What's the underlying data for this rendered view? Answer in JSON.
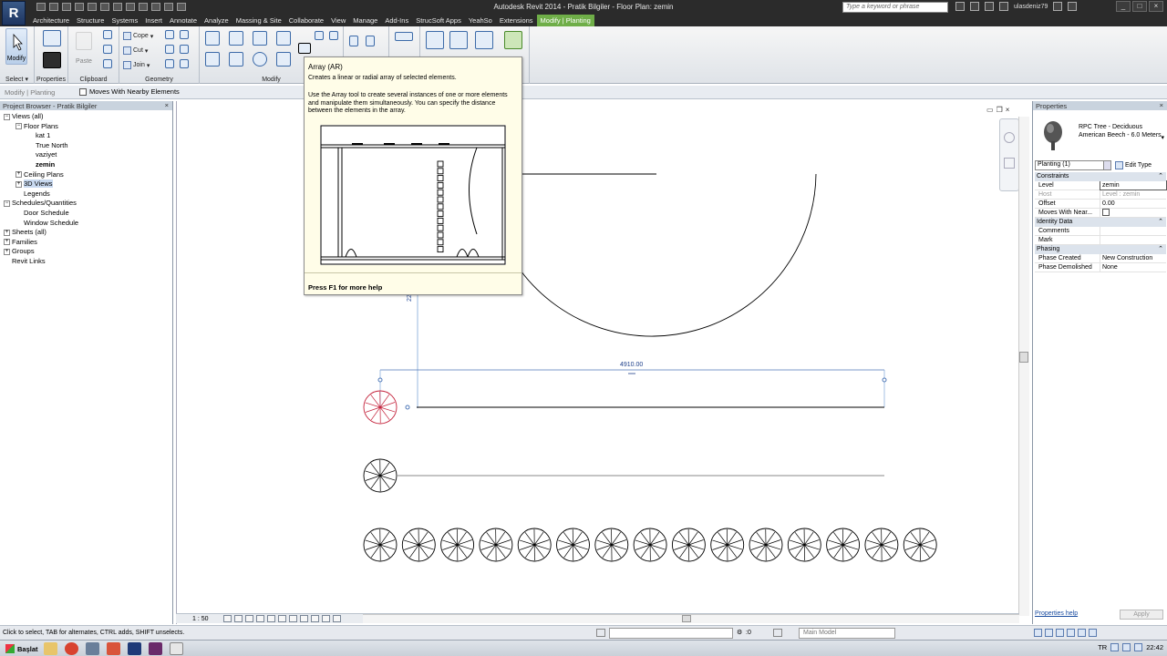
{
  "app": {
    "logo_letter": "R",
    "window_title": "Autodesk Revit 2014 -    Pratik Bilgiler - Floor Plan: zemin",
    "search_placeholder": "Type a keyword or phrase",
    "username": "ulasdeniz79"
  },
  "tabs": [
    {
      "label": "Architecture",
      "active": false
    },
    {
      "label": "Structure",
      "active": false
    },
    {
      "label": "Systems",
      "active": false
    },
    {
      "label": "Insert",
      "active": false
    },
    {
      "label": "Annotate",
      "active": false
    },
    {
      "label": "Analyze",
      "active": false
    },
    {
      "label": "Massing & Site",
      "active": false
    },
    {
      "label": "Collaborate",
      "active": false
    },
    {
      "label": "View",
      "active": false
    },
    {
      "label": "Manage",
      "active": false
    },
    {
      "label": "Add-Ins",
      "active": false
    },
    {
      "label": "StrucSoft Apps",
      "active": false
    },
    {
      "label": "YeahSo",
      "active": false
    },
    {
      "label": "Extensions",
      "active": false
    },
    {
      "label": "Modify | Planting",
      "active": true
    }
  ],
  "ribbon": {
    "modify_label": "Modify",
    "select_label": "Select",
    "properties_panel": "Properties",
    "clipboard_panel": "Clipboard",
    "geometry_panel": "Geometry",
    "modify_panel": "Modify",
    "paste_label": "Paste",
    "cope_label": "Cope",
    "cut_label": "Cut",
    "join_label": "Join"
  },
  "options_bar": {
    "context": "Modify | Planting",
    "moves_label": "Moves With Nearby Elements"
  },
  "project_browser": {
    "title": "Project Browser - Pratik Bilgiler",
    "items": [
      {
        "label": "Views (all)",
        "level": 0,
        "exp": "−"
      },
      {
        "label": "Floor Plans",
        "level": 1,
        "exp": "−"
      },
      {
        "label": "kat 1",
        "level": 2,
        "exp": ""
      },
      {
        "label": "True North",
        "level": 2,
        "exp": ""
      },
      {
        "label": "vaziyet",
        "level": 2,
        "exp": ""
      },
      {
        "label": "zemin",
        "level": 2,
        "exp": "",
        "bold": true
      },
      {
        "label": "Ceiling Plans",
        "level": 1,
        "exp": "+"
      },
      {
        "label": "3D Views",
        "level": 1,
        "exp": "+",
        "highlight": true
      },
      {
        "label": "Legends",
        "level": 1,
        "exp": ""
      },
      {
        "label": "Schedules/Quantities",
        "level": 0,
        "exp": "−"
      },
      {
        "label": "Door Schedule",
        "level": 1,
        "exp": ""
      },
      {
        "label": "Window Schedule",
        "level": 1,
        "exp": ""
      },
      {
        "label": "Sheets (all)",
        "level": 0,
        "exp": "+"
      },
      {
        "label": "Families",
        "level": 0,
        "exp": "+"
      },
      {
        "label": "Groups",
        "level": 0,
        "exp": "+"
      },
      {
        "label": "Revit Links",
        "level": 0,
        "exp": ""
      }
    ]
  },
  "tooltip": {
    "title": "Array (AR)",
    "subtitle": "Creates a linear or radial array of selected elements.",
    "description": "Use the Array tool to create several instances of one or more elements and manipulate them simultaneously. You can specify the distance between the elements in the array.",
    "help": "Press F1 for more help"
  },
  "canvas": {
    "dimension_value": "4910.00",
    "temp_dim": "22",
    "trees_in_array": 15
  },
  "view_control": {
    "scale": "1 : 50"
  },
  "properties": {
    "title": "Properties",
    "type_name": "RPC Tree - Deciduous American Beech - 6.0 Meters",
    "instance_filter": "Planting (1)",
    "edit_type": "Edit Type",
    "groups": [
      {
        "name": "Constraints",
        "rows": [
          {
            "key": "Level",
            "value": "zemin",
            "boxed": true
          },
          {
            "key": "Host",
            "value": "Level : zemin",
            "grey": true
          },
          {
            "key": "Offset",
            "value": "0.00"
          },
          {
            "key": "Moves With Near...",
            "value": "",
            "checkbox": true
          }
        ]
      },
      {
        "name": "Identity Data",
        "rows": [
          {
            "key": "Comments",
            "value": ""
          },
          {
            "key": "Mark",
            "value": ""
          }
        ]
      },
      {
        "name": "Phasing",
        "rows": [
          {
            "key": "Phase Created",
            "value": "New Construction"
          },
          {
            "key": "Phase Demolished",
            "value": "None"
          }
        ]
      }
    ],
    "help_link": "Properties help",
    "apply": "Apply"
  },
  "status": {
    "message": "Click to select, TAB for alternates, CTRL adds, SHIFT unselects.",
    "zero": ":0",
    "model": "Main Model"
  },
  "taskbar": {
    "start": "Başlat",
    "lang": "TR",
    "time": "22:42"
  }
}
